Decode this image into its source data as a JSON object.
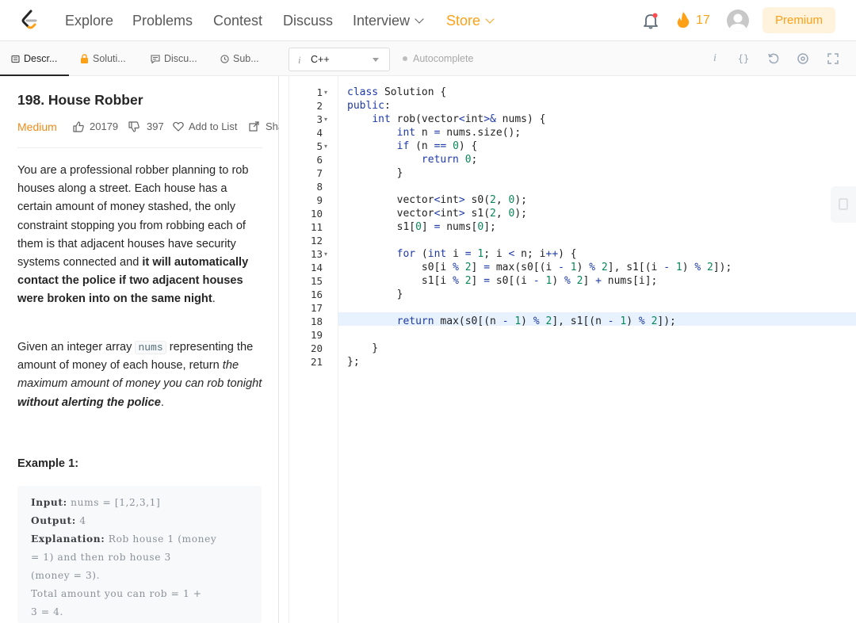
{
  "nav": {
    "links": [
      "Explore",
      "Problems",
      "Contest",
      "Discuss",
      "Interview",
      "Store"
    ],
    "streak": "17",
    "premium": "Premium"
  },
  "tabs": [
    "Descr...",
    "Soluti...",
    "Discu...",
    "Sub..."
  ],
  "editor_bar": {
    "language": "C++",
    "autocomplete": "Autocomplete",
    "tool_icons": [
      "info-icon",
      "braces-icon",
      "reset-icon",
      "settings-icon",
      "fullscreen-icon"
    ]
  },
  "problem": {
    "title": "198. House Robber",
    "difficulty": "Medium",
    "likes": "20179",
    "dislikes": "397",
    "add_to_list": "Add to List",
    "share": "Share",
    "p1": {
      "a": "You are a professional robber planning to rob houses along a street. Each house has a certain amount of money stashed, the only constraint stopping you from robbing each of them is that adjacent houses have security systems connected and ",
      "b": "it will automatically contact the police if two adjacent houses were broken into on the same night",
      "c": "."
    },
    "p2": {
      "a": "Given an integer array ",
      "code": "nums",
      "b": " representing the amount of money of each house, return ",
      "c": "the maximum amount of money you can rob tonight ",
      "d": "without alerting the police",
      "e": "."
    },
    "example_title": "Example 1:",
    "example": {
      "input_label": "Input:",
      "input": "nums = [1,2,3,1]",
      "output_label": "Output:",
      "output": "4",
      "explanation_label": "Explanation:",
      "explanation_1": "Rob house 1 (money",
      "explanation_2": "= 1) and then rob house 3",
      "explanation_3": "(money = 3).",
      "explanation_4": "Total amount you can rob = 1 +",
      "explanation_5": "3 = 4."
    }
  },
  "code": {
    "line_numbers": [
      "1",
      "2",
      "3",
      "4",
      "5",
      "6",
      "7",
      "8",
      "9",
      "10",
      "11",
      "12",
      "13",
      "14",
      "15",
      "16",
      "17",
      "18",
      "19",
      "20",
      "21"
    ],
    "lines": [
      "class Solution {",
      "public:",
      "    int rob(vector<int>& nums) {",
      "        int n = nums.size();",
      "        if (n == 0) {",
      "            return 0;",
      "        }",
      "",
      "        vector<int> s0(2, 0);",
      "        vector<int> s1(2, 0);",
      "        s1[0] = nums[0];",
      "",
      "        for (int i = 1; i < n; i++) {",
      "            s0[i % 2] = max(s0[(i - 1) % 2], s1[(i - 1) % 2]);",
      "            s1[i % 2] = s0[(i - 1) % 2] + nums[i];",
      "        }",
      "",
      "        return max(s0[(n - 1) % 2], s1[(n - 1) % 2]);",
      "",
      "    }",
      "};"
    ]
  }
}
